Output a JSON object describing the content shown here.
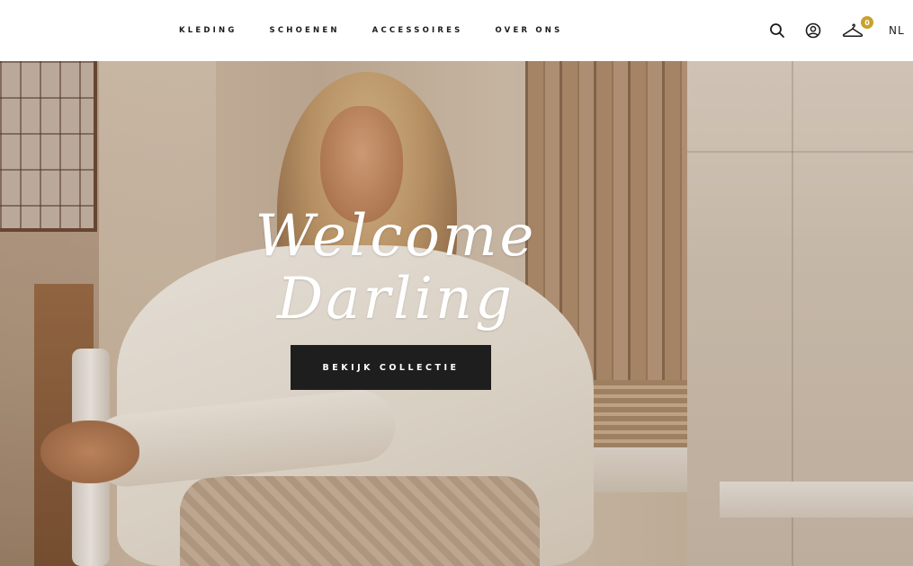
{
  "header": {
    "nav": [
      {
        "label": "KLEDING"
      },
      {
        "label": "SCHOENEN"
      },
      {
        "label": "ACCESSOIRES"
      },
      {
        "label": "OVER ONS"
      }
    ],
    "icons": {
      "search": "search-icon",
      "account": "account-icon",
      "cart": "hanger-icon"
    },
    "cart_count": "0",
    "language": "NL",
    "colors": {
      "badge": "#c9a12a",
      "text": "#1a1a1a",
      "background": "#ffffff"
    }
  },
  "hero": {
    "headline": "Welcome Darling",
    "cta_label": "BEKIJK COLLECTIE",
    "colors": {
      "button": "#1e1e1e",
      "headline": "#ffffff"
    }
  }
}
